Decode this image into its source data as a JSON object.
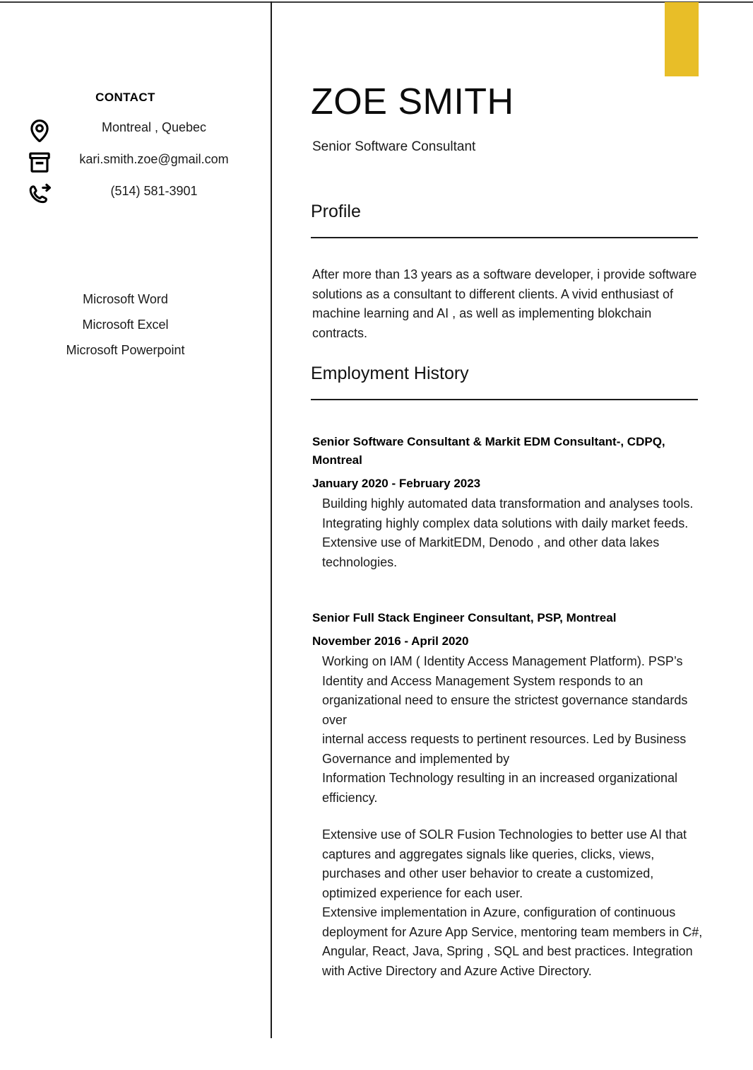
{
  "theme": {
    "accent_color": "#e8be28",
    "rule_color": "#1b1b1b",
    "text_color": "#1a1a1a"
  },
  "header": {
    "name": "ZOE SMITH",
    "role": "Senior Software Consultant"
  },
  "sidebar": {
    "contact_heading": "CONTACT",
    "contact_items": [
      {
        "icon": "location-pin-icon",
        "value": "Montreal , Quebec"
      },
      {
        "icon": "inbox-icon",
        "value": "kari.smith.zoe@gmail.com"
      },
      {
        "icon": "phone-outgoing-icon",
        "value": "(514) 581-3901"
      }
    ],
    "skills": [
      "Microsoft Word",
      "Microsoft Excel",
      "Microsoft Powerpoint"
    ]
  },
  "main": {
    "profile": {
      "title": "Profile",
      "body": "After more than 13 years as a software developer, i provide software solutions as a consultant to different clients. A vivid enthusiast of machine learning and AI , as well as implementing blokchain contracts."
    },
    "employment": {
      "title": "Employment History",
      "jobs": [
        {
          "title": "Senior Software Consultant & Markit EDM Consultant-, CDPQ, Montreal",
          "dates": "January 2020 - February 2023",
          "paragraphs": [
            "Building highly automated data transformation and analyses tools.",
            "Integrating highly complex data solutions with daily market feeds. Extensive use of MarkitEDM, Denodo , and other data lakes technologies."
          ]
        },
        {
          "title": "Senior Full Stack Engineer Consultant, PSP, Montreal",
          "dates": "November 2016 - April 2020",
          "paragraphs": [
            "Working on IAM ( Identity Access Management Platform). PSP’s Identity and Access Management System responds to an organizational need to ensure the strictest governance standards over",
            "internal access requests to pertinent resources. Led by Business Governance and implemented by",
            "Information Technology resulting in an increased organizational efficiency.",
            "Extensive use of SOLR Fusion Technologies to better use AI that captures and aggregates signals like queries, clicks, views, purchases and other user behavior to create a customized, optimized experience for each user.",
            "Extensive implementation in Azure, configuration of continuous deployment for Azure App Service, mentoring team members in C#, Angular, React, Java, Spring , SQL and best practices. Integration with Active Directory and Azure Active Directory."
          ]
        }
      ]
    }
  }
}
